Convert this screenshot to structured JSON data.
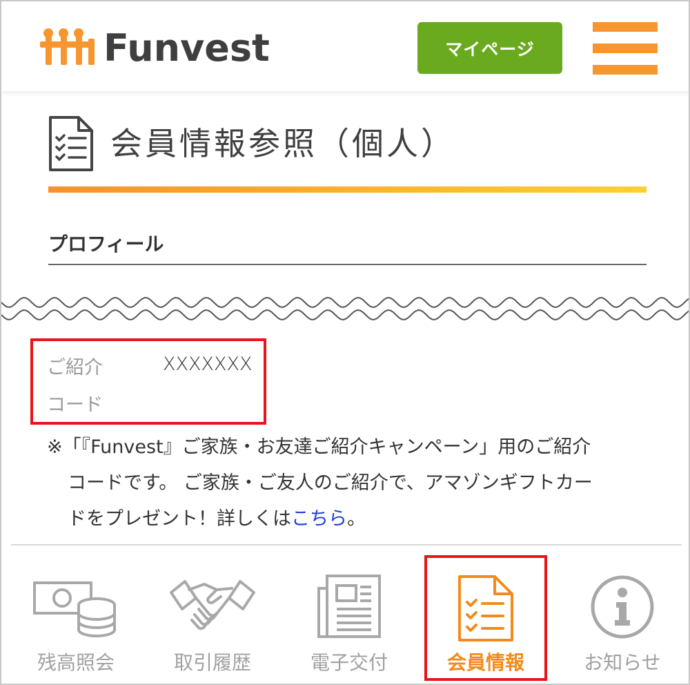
{
  "header": {
    "logo_text": "Funvest",
    "mypage_label": "マイページ"
  },
  "page": {
    "title": "会員情報参照（個人）",
    "section_heading": "プロフィール"
  },
  "referral": {
    "label_line1": "ご紹介",
    "label_line2": "コード",
    "value": "XXXXXXX"
  },
  "note": {
    "line1": "※「『Funvest』ご家族・お友達ご紹介キャンペーン」用のご紹介",
    "line2": "コードです。 ご家族・ご友人のご紹介で、アマゾンギフトカー",
    "line3_prefix": "ドをプレゼント！詳しくは",
    "link": "こちら",
    "line3_suffix": "。"
  },
  "nav": {
    "items": [
      {
        "label": "残高照会",
        "icon": "balance-icon",
        "active": false
      },
      {
        "label": "取引履歴",
        "icon": "handshake-icon",
        "active": false
      },
      {
        "label": "電子交付",
        "icon": "newspaper-icon",
        "active": false
      },
      {
        "label": "会員情報",
        "icon": "document-list-icon",
        "active": true
      },
      {
        "label": "お知らせ",
        "icon": "info-icon",
        "active": false
      }
    ]
  },
  "colors": {
    "accent_orange": "#f7952e",
    "mypage_green": "#6aaa1e",
    "highlight_red": "#e8141a",
    "link_blue": "#1e3fd8"
  }
}
